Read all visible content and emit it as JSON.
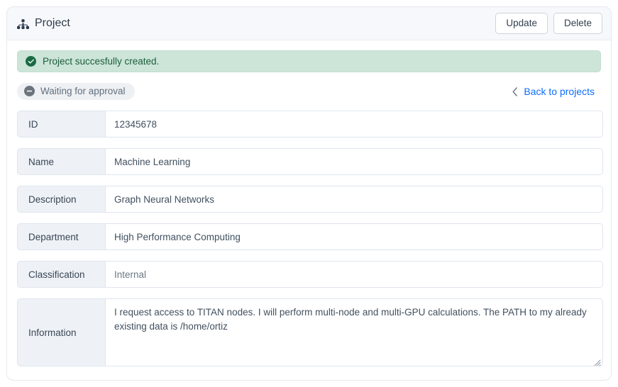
{
  "header": {
    "icon": "diagram-3-icon",
    "title": "Project",
    "update_label": "Update",
    "delete_label": "Delete"
  },
  "alert": {
    "icon": "check-circle-fill-icon",
    "message": "Project succesfully created.",
    "bg_color": "#cce5d8",
    "text_color": "#1d5c3b"
  },
  "status": {
    "icon": "dash-circle-fill-icon",
    "label": "Waiting for approval",
    "badge_bg": "#eef0f3",
    "badge_text_color": "#62707e"
  },
  "back_link": {
    "icon": "chevron-left-icon",
    "label": "Back to projects",
    "color": "#0d6efd"
  },
  "fields": [
    {
      "label": "ID",
      "value": "12345678",
      "muted": false
    },
    {
      "label": "Name",
      "value": "Machine Learning",
      "muted": false
    },
    {
      "label": "Description",
      "value": "Graph Neural Networks",
      "muted": false
    },
    {
      "label": "Department",
      "value": "High Performance Computing",
      "muted": false
    },
    {
      "label": "Classification",
      "value": "Internal",
      "muted": true
    }
  ],
  "information": {
    "label": "Information",
    "value": "I request access to TITAN nodes. I will perform multi-node and multi-GPU calculations. The PATH to my already existing data is /home/ortiz",
    "resize_handle": "resize-grip-icon"
  },
  "colors": {
    "card_bg": "#ffffff",
    "header_bg": "#f7f8fb",
    "label_bg": "#eef2f7",
    "border": "#dfe5ee",
    "accent": "#0d6efd"
  }
}
